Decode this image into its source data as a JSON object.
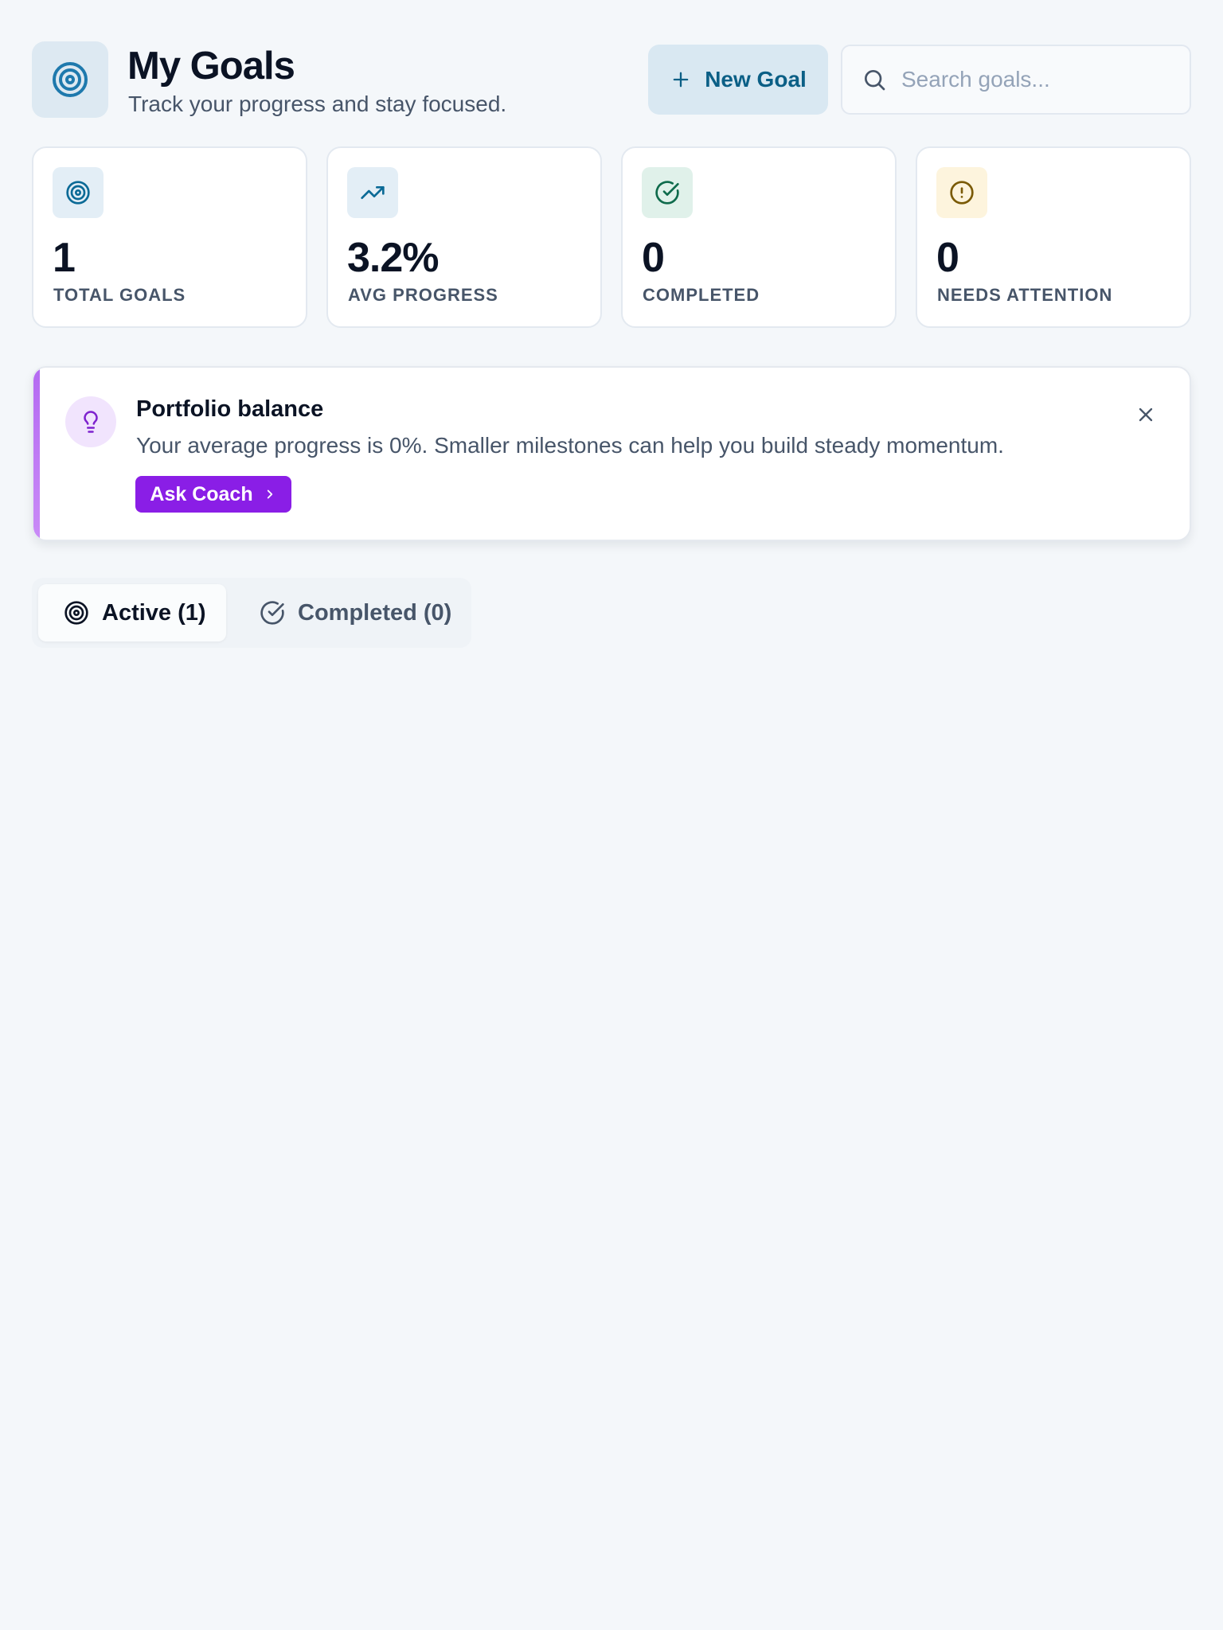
{
  "header": {
    "title": "My Goals",
    "subtitle": "Track your progress and stay focused.",
    "logo_icon": "target-icon",
    "new_goal_label": "New Goal",
    "search_placeholder": "Search goals..."
  },
  "stats": [
    {
      "value": "1",
      "label": "TOTAL GOALS",
      "icon": "target-icon",
      "color": "#0b6a96",
      "bg": "#e3eef6"
    },
    {
      "value": "3.2%",
      "label": "AVG PROGRESS",
      "icon": "trending-up-icon",
      "color": "#0b6a96",
      "bg": "#e3eef6"
    },
    {
      "value": "0",
      "label": "COMPLETED",
      "icon": "check-circle-icon",
      "color": "#0f6b4c",
      "bg": "#e0f1ea"
    },
    {
      "value": "0",
      "label": "NEEDS ATTENTION",
      "icon": "alert-circle-icon",
      "color": "#7a5a05",
      "bg": "#fdf4dd"
    }
  ],
  "insight": {
    "title": "Portfolio balance",
    "text": "Your average progress is 0%. Smaller milestones can help you build steady momentum.",
    "button_label": "Ask Coach",
    "icon": "lightbulb-icon",
    "accent_color": "#8a1ee6"
  },
  "tabs": [
    {
      "label": "Active (1)",
      "icon": "target-icon",
      "active": true
    },
    {
      "label": "Completed (0)",
      "icon": "check-circle-icon",
      "active": false
    }
  ],
  "colors": {
    "background": "#f4f7fa",
    "primary": "#0b6a96",
    "accent": "#8a1ee6"
  }
}
